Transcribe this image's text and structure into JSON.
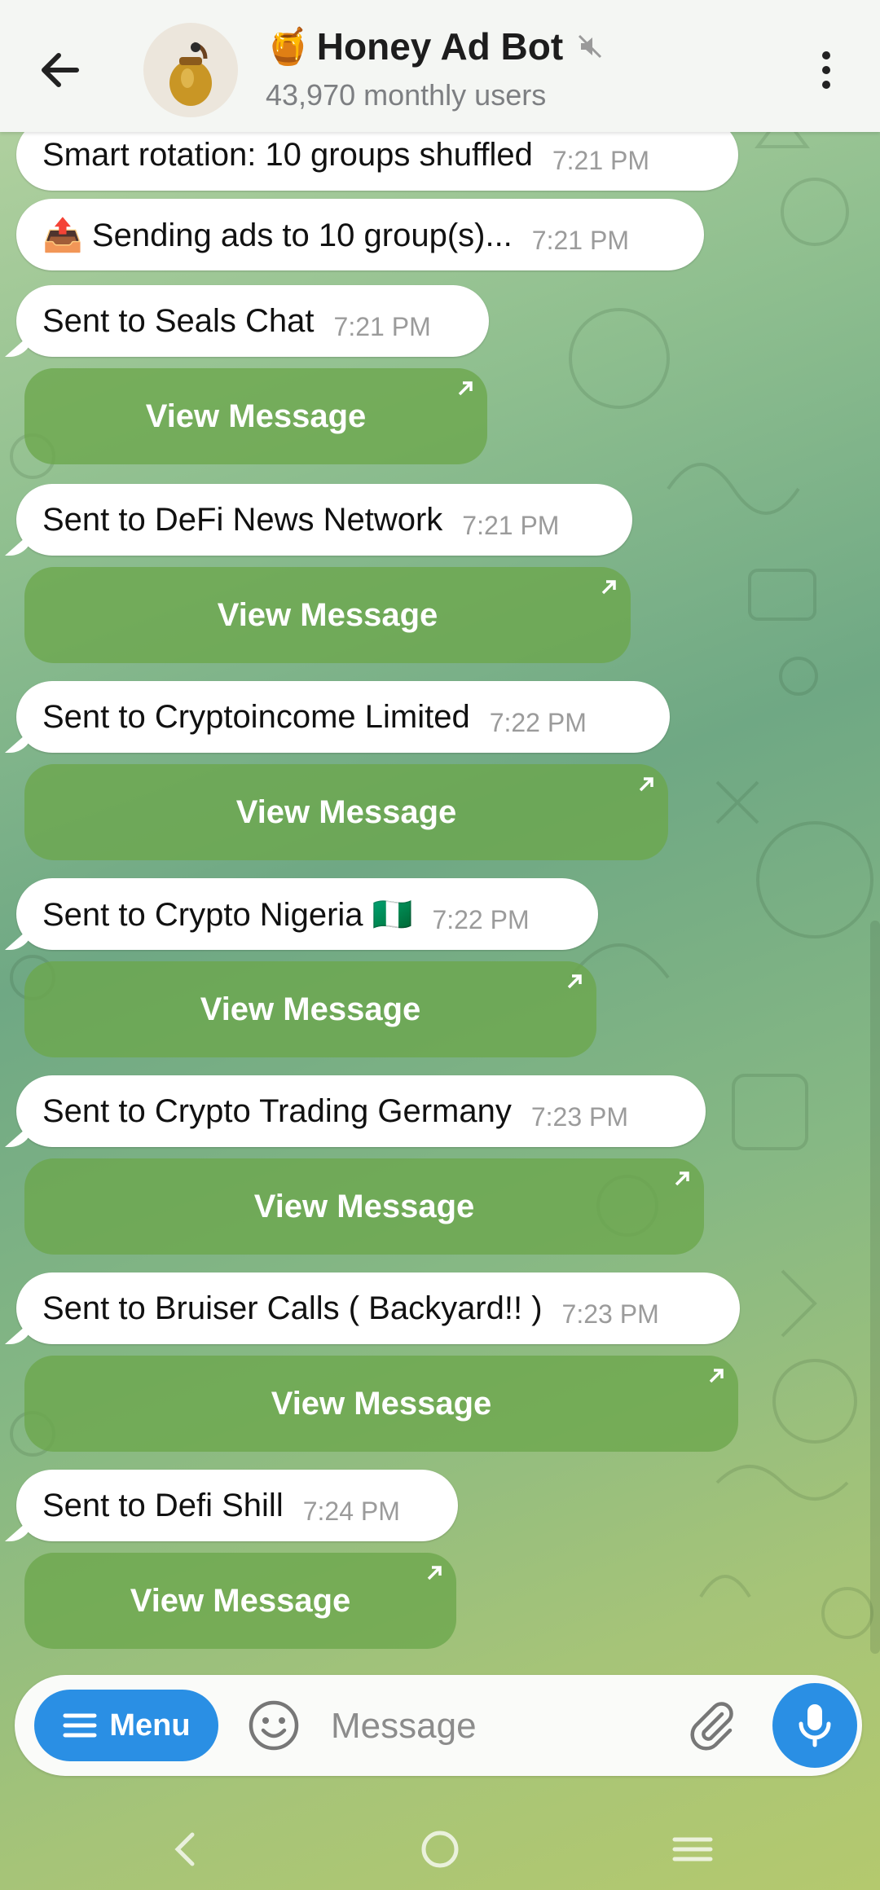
{
  "header": {
    "title_emoji": "🍯",
    "title": "Honey Ad Bot",
    "subtitle": "43,970 monthly users"
  },
  "messages": [
    {
      "text": "Smart rotation: 10 groups shuffled",
      "time": "7:21 PM"
    },
    {
      "text": "📤 Sending ads to 10 group(s)...",
      "time": "7:21 PM"
    },
    {
      "text": "Sent to Seals Chat",
      "time": "7:21 PM",
      "button": "View Message"
    },
    {
      "text": "Sent to DeFi News Network",
      "time": "7:21 PM",
      "button": "View Message"
    },
    {
      "text": "Sent to Cryptoincome Limited",
      "time": "7:22 PM",
      "button": "View Message"
    },
    {
      "text": "Sent to Crypto Nigeria 🇳🇬",
      "time": "7:22 PM",
      "button": "View Message"
    },
    {
      "text": "Sent to Crypto Trading Germany",
      "time": "7:23 PM",
      "button": "View Message"
    },
    {
      "text": "Sent to Bruiser Calls ( Backyard!! )",
      "time": "7:23 PM",
      "button": "View Message"
    },
    {
      "text": "Sent to Defi Shill",
      "time": "7:24 PM",
      "button": "View Message"
    }
  ],
  "input": {
    "menu_label": "Menu",
    "placeholder": "Message"
  },
  "icons": {
    "back": "arrow-left-icon",
    "mute": "muted-speaker-icon",
    "more": "vertical-dots-icon",
    "emoji": "smiley-icon",
    "attach": "paperclip-icon",
    "mic": "microphone-icon"
  },
  "colors": {
    "accent": "#2a8fe4",
    "inline_button": "#6ca64c"
  }
}
